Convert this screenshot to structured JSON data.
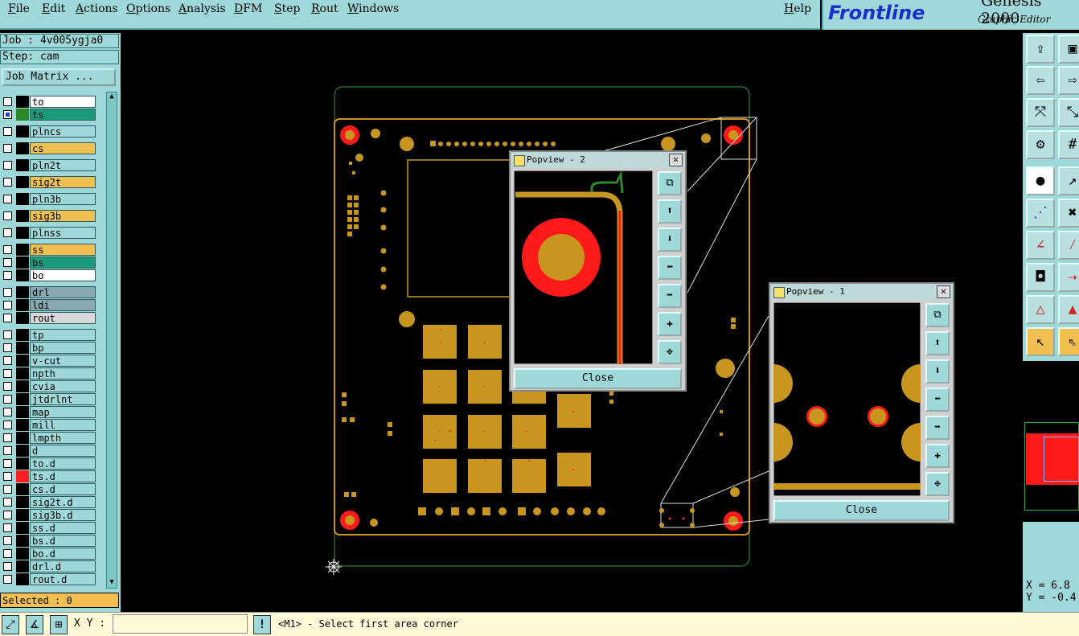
{
  "menu": [
    "File",
    "Edit",
    "Actions",
    "Options",
    "Analysis",
    "DFM",
    "Step",
    "Rout",
    "Windows"
  ],
  "help": "Help",
  "brand": {
    "name": "Frontline",
    "product": "Genesis 2000",
    "subtitle": "Graphic Editor"
  },
  "job": {
    "job_label": "Job : 4v005ygja0",
    "step_label": "Step: cam",
    "matrix_button": "Job Matrix ..."
  },
  "layers": [
    {
      "name": "to",
      "color": "#ffffff",
      "swatch": "#000000"
    },
    {
      "name": "ts",
      "color": "#1a9a7a",
      "swatch": "#2a8a2a",
      "checked": true
    },
    {
      "name": "plncs",
      "color": "#9fd8d8",
      "swatch": "#000000"
    },
    {
      "name": "cs",
      "color": "#f2c050",
      "swatch": "#000000"
    },
    {
      "name": "pln2t",
      "color": "#9fd8d8",
      "swatch": "#000000"
    },
    {
      "name": "sig2t",
      "color": "#f2c050",
      "swatch": "#000000"
    },
    {
      "name": "pln3b",
      "color": "#9fd8d8",
      "swatch": "#000000"
    },
    {
      "name": "sig3b",
      "color": "#f2c050",
      "swatch": "#000000"
    },
    {
      "name": "plnss",
      "color": "#9fd8d8",
      "swatch": "#000000"
    },
    {
      "name": "ss",
      "color": "#f2c050",
      "swatch": "#000000"
    },
    {
      "name": "bs",
      "color": "#1a9a7a",
      "swatch": "#000000"
    },
    {
      "name": "bo",
      "color": "#ffffff",
      "swatch": "#000000"
    },
    {
      "name": "drl",
      "color": "#8aa8b0",
      "swatch": "#000000"
    },
    {
      "name": "ldi",
      "color": "#8aa8b0",
      "swatch": "#000000"
    },
    {
      "name": "rout",
      "color": "#d8d8d8",
      "swatch": "#000000"
    },
    {
      "name": "tp",
      "color": "#9fd8d8",
      "swatch": "#000000"
    },
    {
      "name": "bp",
      "color": "#9fd8d8",
      "swatch": "#000000"
    },
    {
      "name": "v-cut",
      "color": "#9fd8d8",
      "swatch": "#000000"
    },
    {
      "name": "npth",
      "color": "#9fd8d8",
      "swatch": "#000000"
    },
    {
      "name": "cvia",
      "color": "#9fd8d8",
      "swatch": "#000000"
    },
    {
      "name": "jtdrlnt",
      "color": "#9fd8d8",
      "swatch": "#000000"
    },
    {
      "name": "map",
      "color": "#9fd8d8",
      "swatch": "#000000"
    },
    {
      "name": "mill",
      "color": "#9fd8d8",
      "swatch": "#000000"
    },
    {
      "name": "lmpth",
      "color": "#9fd8d8",
      "swatch": "#000000"
    },
    {
      "name": "d",
      "color": "#9fd8d8",
      "swatch": "#000000"
    },
    {
      "name": "to.d",
      "color": "#9fd8d8",
      "swatch": "#000000"
    },
    {
      "name": "ts.d",
      "color": "#9fd8d8",
      "swatch": "#ff2020"
    },
    {
      "name": "cs.d",
      "color": "#9fd8d8",
      "swatch": "#000000"
    },
    {
      "name": "sig2t.d",
      "color": "#9fd8d8",
      "swatch": "#000000"
    },
    {
      "name": "sig3b.d",
      "color": "#9fd8d8",
      "swatch": "#000000"
    },
    {
      "name": "ss.d",
      "color": "#9fd8d8",
      "swatch": "#000000"
    },
    {
      "name": "bs.d",
      "color": "#9fd8d8",
      "swatch": "#000000"
    },
    {
      "name": "bo.d",
      "color": "#9fd8d8",
      "swatch": "#000000"
    },
    {
      "name": "drl.d",
      "color": "#9fd8d8",
      "swatch": "#000000"
    },
    {
      "name": "rout.d",
      "color": "#9fd8d8",
      "swatch": "#000000"
    }
  ],
  "selected": "Selected : 0",
  "status": {
    "xy_label": "X Y :",
    "xy_value": "",
    "message": "<M1> - Select first area corner"
  },
  "coords": {
    "x": "X = 6.8",
    "y": "Y = -0.4"
  },
  "popview2": {
    "title": "Popview - 2",
    "close": "Close"
  },
  "popview1": {
    "title": "Popview - 1",
    "close": "Close"
  }
}
